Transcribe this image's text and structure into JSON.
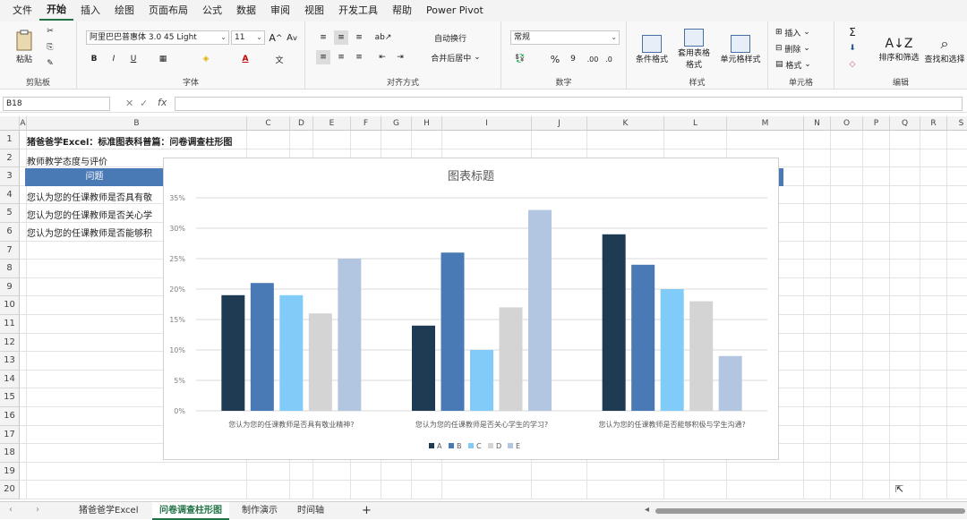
{
  "menu": {
    "items": [
      "文件",
      "开始",
      "插入",
      "绘图",
      "页面布局",
      "公式",
      "数据",
      "审阅",
      "视图",
      "开发工具",
      "帮助",
      "Power Pivot"
    ],
    "active_index": 1
  },
  "ribbon": {
    "clipboard": {
      "paste": "粘贴",
      "label": "剪贴板"
    },
    "font": {
      "name": "阿里巴巴普惠体 3.0 45 Light",
      "size": "11",
      "bold": "B",
      "italic": "I",
      "underline": "U",
      "label": "字体"
    },
    "alignment": {
      "wrap": "自动换行",
      "merge": "合并后居中",
      "label": "对齐方式"
    },
    "number": {
      "format": "常规",
      "label": "数字"
    },
    "styles": {
      "conditional": "条件格式",
      "table": "套用表格格式",
      "cell_styles": "单元格样式",
      "label": "样式"
    },
    "cells": {
      "insert": "插入",
      "delete": "删除",
      "format": "格式",
      "label": "单元格"
    },
    "editing": {
      "sort": "排序和筛选",
      "find": "查找和选择",
      "label": "编辑"
    }
  },
  "formula_bar": {
    "name_box": "B18",
    "fx": "fx",
    "value": ""
  },
  "columns": [
    "A",
    "B",
    "C",
    "D",
    "E",
    "F",
    "G",
    "H",
    "I",
    "J",
    "K",
    "L",
    "M",
    "N",
    "O",
    "P",
    "Q",
    "R",
    "S"
  ],
  "rows": [
    "1",
    "2",
    "3",
    "4",
    "5",
    "6",
    "7",
    "8",
    "9",
    "10",
    "11",
    "12",
    "13",
    "14",
    "15",
    "16",
    "17",
    "18",
    "19",
    "20"
  ],
  "cells": {
    "b1": "猪爸爸学Excel：标准图表科普篇：问卷调查柱形图",
    "b2": "教师教学态度与评价",
    "b3": "问题",
    "b4": "您认为您的任课教师是否具有敬",
    "b5": "您认为您的任课教师是否关心学",
    "b6": "您认为您的任课教师是否能够积"
  },
  "chart_data": {
    "type": "bar",
    "title": "图表标题",
    "categories": [
      "您认为您的任课教师是否具有敬业精神?",
      "您认为您的任课教师是否关心学生的学习?",
      "您认为您的任课教师是否能够积极与学生沟通?"
    ],
    "series": [
      {
        "name": "A",
        "values": [
          19,
          14,
          29
        ],
        "color": "#1f3b54"
      },
      {
        "name": "B",
        "values": [
          21,
          26,
          24
        ],
        "color": "#4a7ab5"
      },
      {
        "name": "C",
        "values": [
          19,
          10,
          20
        ],
        "color": "#80cbf7"
      },
      {
        "name": "D",
        "values": [
          16,
          17,
          18
        ],
        "color": "#d4d4d4"
      },
      {
        "name": "E",
        "values": [
          25,
          33,
          9
        ],
        "color": "#b2c6e1"
      }
    ],
    "ylim": [
      0,
      35
    ],
    "yticks": [
      "0%",
      "5%",
      "10%",
      "15%",
      "20%",
      "25%",
      "30%",
      "35%"
    ],
    "legend": "bottom",
    "grid": true
  },
  "sheet_tabs": {
    "tabs": [
      "猪爸爸学Excel",
      "问卷调查柱形图",
      "制作演示",
      "时间轴"
    ],
    "active_index": 1,
    "add": "+"
  }
}
